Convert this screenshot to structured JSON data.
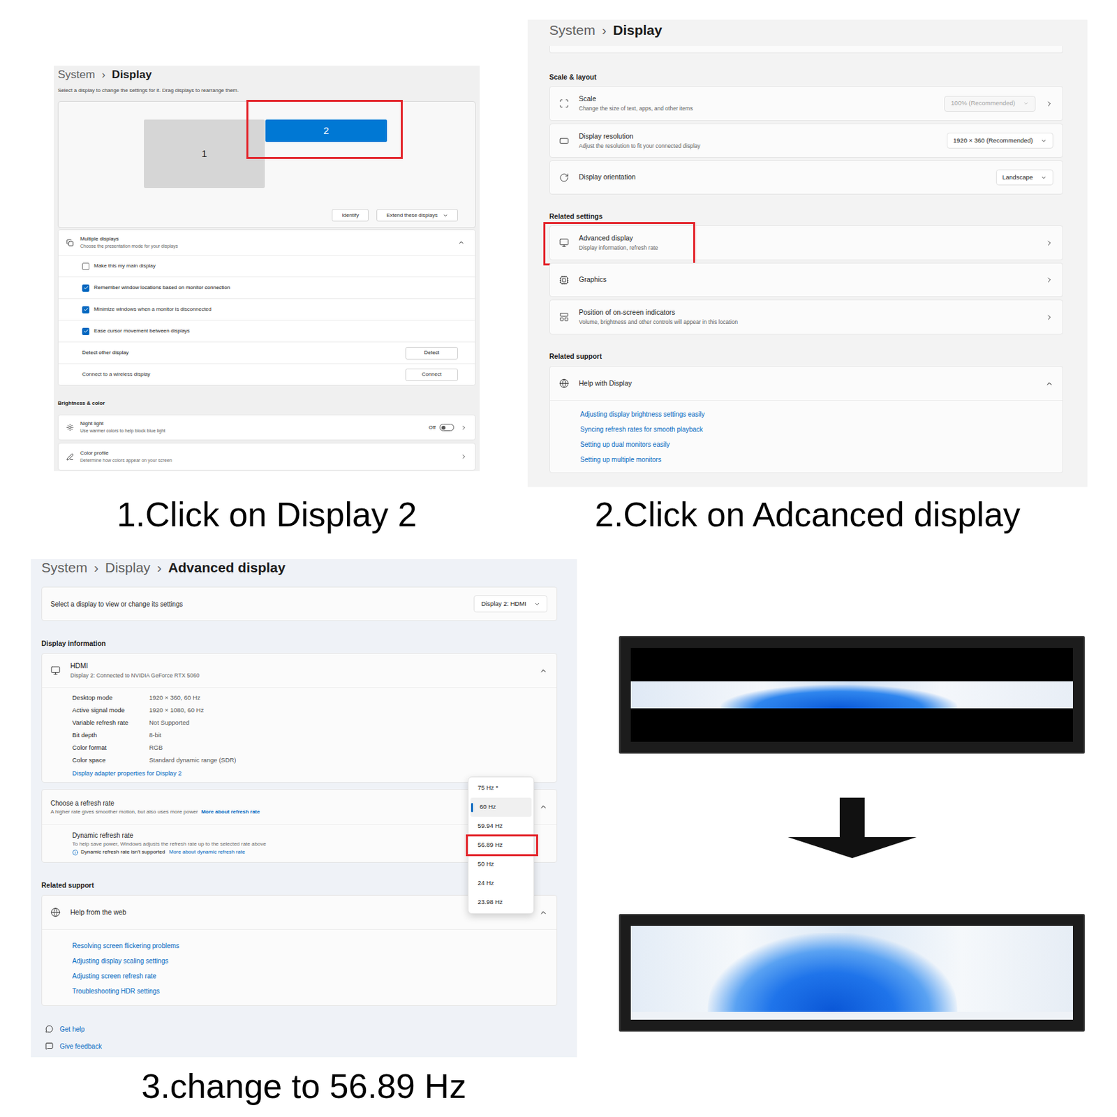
{
  "captions": [
    "1.Click on Display 2",
    "2.Click on Adcanced display",
    "3.change to 56.89 Hz"
  ],
  "panel1": {
    "breadcrumb": [
      "System",
      "Display"
    ],
    "separator": "›",
    "description": "Select a display to change the settings for it. Drag displays to rearrange them.",
    "displays": [
      {
        "label": "1",
        "selected": false,
        "highlighted": false
      },
      {
        "label": "2",
        "selected": true,
        "highlighted": true
      }
    ],
    "buttons": [
      {
        "label": "Identify",
        "dropdown": false
      },
      {
        "label": "Extend these displays",
        "dropdown": true
      }
    ],
    "multiple_displays": {
      "title": "Multiple displays",
      "subtitle": "Choose the presentation mode for your displays",
      "expanded": true
    },
    "checkboxes": [
      {
        "label": "Make this my main display",
        "checked": false
      },
      {
        "label": "Remember window locations based on monitor connection",
        "checked": true
      },
      {
        "label": "Minimize windows when a monitor is disconnected",
        "checked": true
      },
      {
        "label": "Ease cursor movement between displays",
        "checked": true
      }
    ],
    "actions": [
      {
        "label": "Detect other display",
        "button": "Detect"
      },
      {
        "label": "Connect to a wireless display",
        "button": "Connect"
      }
    ],
    "section": "Brightness & color",
    "rows": [
      {
        "title": "Night light",
        "subtitle": "Use warmer colors to help block blue light",
        "kind": "toggle",
        "value": "Off",
        "on": false
      },
      {
        "title": "Color profile",
        "subtitle": "Determine how colors appear on your screen",
        "kind": "link",
        "value": "",
        "on": false
      }
    ]
  },
  "panel2": {
    "breadcrumb": [
      "System",
      "Display"
    ],
    "separator": "›",
    "sections": [
      {
        "title": "Scale & layout",
        "rows": [
          {
            "title": "Scale",
            "subtitle": "Change the size of text, apps, and other items",
            "kind": "dropdown-link",
            "value": "100% (Recommended)",
            "disabled": true,
            "highlighted": false
          },
          {
            "title": "Display resolution",
            "subtitle": "Adjust the resolution to fit your connected display",
            "kind": "dropdown",
            "value": "1920 × 360 (Recommended)",
            "disabled": false,
            "highlighted": false
          },
          {
            "title": "Display orientation",
            "subtitle": "",
            "kind": "dropdown",
            "value": "Landscape",
            "disabled": false,
            "highlighted": false
          }
        ]
      },
      {
        "title": "Related settings",
        "rows": [
          {
            "title": "Advanced display",
            "subtitle": "Display information, refresh rate",
            "kind": "link",
            "value": "",
            "disabled": false,
            "highlighted": true
          },
          {
            "title": "Graphics",
            "subtitle": "",
            "kind": "link",
            "value": "",
            "disabled": false,
            "highlighted": false
          },
          {
            "title": "Position of on-screen indicators",
            "subtitle": "Volume, brightness and other controls will appear in this location",
            "kind": "link",
            "value": "",
            "disabled": false,
            "highlighted": false
          }
        ]
      }
    ],
    "support": {
      "title": "Related support",
      "header": "Help with Display",
      "expanded": true,
      "links": [
        "Adjusting display brightness settings easily",
        "Syncing refresh rates for smooth playback",
        "Setting up dual monitors easily",
        "Setting up multiple monitors"
      ]
    }
  },
  "panel3": {
    "breadcrumb": [
      "System",
      "Display",
      "Advanced display"
    ],
    "separator": "›",
    "select": {
      "label": "Select a display to view or change its settings",
      "value": "Display 2: HDMI"
    },
    "info_title": "Display information",
    "info": {
      "title": "HDMI",
      "subtitle": "Display 2: Connected to NVIDIA GeForce RTX 5060",
      "expanded": true,
      "rows": [
        {
          "label": "Desktop mode",
          "value": "1920 × 360, 60 Hz"
        },
        {
          "label": "Active signal mode",
          "value": "1920 × 1080, 60 Hz"
        },
        {
          "label": "Variable refresh rate",
          "value": "Not Supported"
        },
        {
          "label": "Bit depth",
          "value": "8-bit"
        },
        {
          "label": "Color format",
          "value": "RGB"
        },
        {
          "label": "Color space",
          "value": "Standard dynamic range (SDR)"
        }
      ],
      "link": "Display adapter properties for Display 2"
    },
    "refresh": {
      "title": "Choose a refresh rate",
      "subtitle": "A higher rate gives smoother motion, but also uses more power",
      "link": "More about refresh rate",
      "expanded": true,
      "dynamic": {
        "title": "Dynamic refresh rate",
        "subtitle": "To help save power, Windows adjusts the refresh rate up to the selected rate above",
        "note": "Dynamic refresh rate isn't supported",
        "link": "More about dynamic refresh rate"
      },
      "options": [
        {
          "label": "75 Hz *",
          "selected": false,
          "highlighted": false
        },
        {
          "label": "60 Hz",
          "selected": true,
          "highlighted": false
        },
        {
          "label": "59.94 Hz",
          "selected": false,
          "highlighted": false
        },
        {
          "label": "56.89 Hz",
          "selected": false,
          "highlighted": true
        },
        {
          "label": "50 Hz",
          "selected": false,
          "highlighted": false
        },
        {
          "label": "24 Hz",
          "selected": false,
          "highlighted": false
        },
        {
          "label": "23.98 Hz",
          "selected": false,
          "highlighted": false
        }
      ]
    },
    "support": {
      "title": "Related support",
      "header": "Help from the web",
      "expanded": true,
      "links": [
        "Resolving screen flickering problems",
        "Adjusting display scaling settings",
        "Adjusting screen refresh rate",
        "Troubleshooting HDR settings"
      ]
    },
    "footer": [
      "Get help",
      "Give feedback"
    ]
  }
}
